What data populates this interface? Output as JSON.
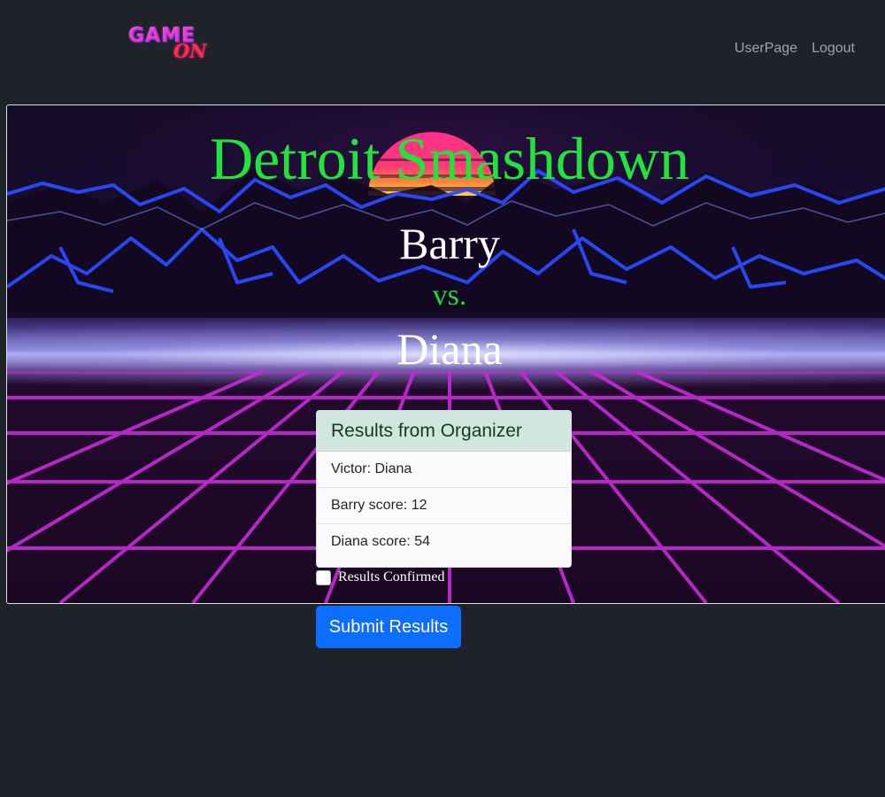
{
  "navbar": {
    "logo": {
      "word1": "GAME",
      "word2": "ON"
    },
    "links": [
      {
        "label": "UserPage"
      },
      {
        "label": "Logout"
      }
    ]
  },
  "hero": {
    "title": "Detroit Smashdown",
    "player1": "Barry",
    "vs": "vs.",
    "player2": "Diana"
  },
  "results_card": {
    "header": "Results from Organizer",
    "rows": [
      {
        "text": "Victor: Diana"
      },
      {
        "text": "Barry score: 12"
      },
      {
        "text": "Diana score: 54"
      }
    ]
  },
  "confirm": {
    "label": "Results Confirmed",
    "checked": false
  },
  "submit": {
    "label": "Submit Results"
  },
  "colors": {
    "background": "#1e2229",
    "title_green": "#22e33c",
    "button_blue": "#0d6efd",
    "card_header": "#d1e7dd"
  }
}
